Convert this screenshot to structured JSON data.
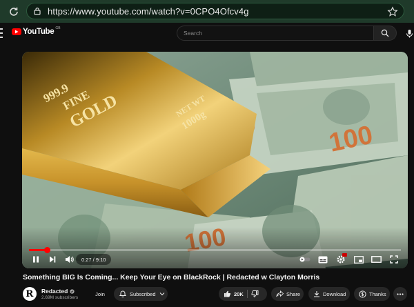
{
  "browser": {
    "url": "https://www.youtube.com/watch?v=0CPO4Ofcv4g",
    "accent_color": "#1f3a2a"
  },
  "masthead": {
    "logo_text": "YouTube",
    "region": "GB",
    "search_placeholder": "Search"
  },
  "video": {
    "gold_bar_text": [
      "999.9",
      "FINE",
      "GOLD"
    ],
    "gold_bar_side_text": [
      "NET WT",
      "1000g"
    ],
    "bill_denomination": "100",
    "current_time": "0:27",
    "duration": "9:10",
    "time_display": "0:27 / 9:10",
    "progress": 0.049,
    "cc_enabled": true,
    "progress_color": "#ff0000"
  },
  "meta": {
    "title": "Something BIG Is Coming... Keep Your Eye on BlackRock | Redacted w Clayton Morris",
    "channel_initial": "R",
    "channel_name": "Redacted",
    "subscribers": "2.69M subscribers",
    "join_label": "Join",
    "subscribed_label": "Subscribed",
    "like_count": "20K",
    "share_label": "Share",
    "download_label": "Download",
    "thanks_label": "Thanks"
  }
}
